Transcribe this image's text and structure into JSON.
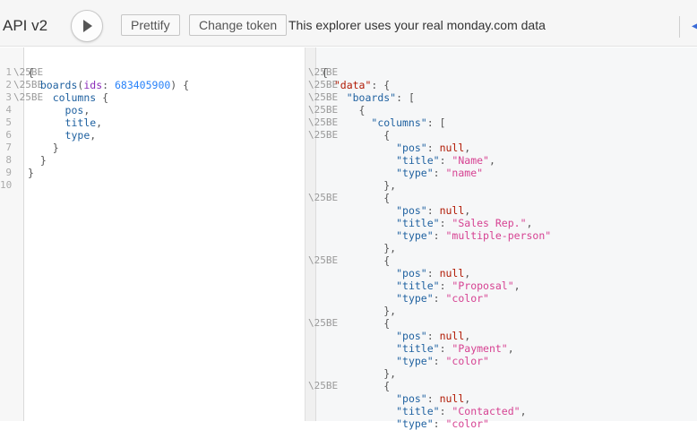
{
  "toolbar": {
    "title": "API v2",
    "prettify_label": "Prettify",
    "change_token_label": "Change token",
    "notice": "This explorer uses your real monday.com data",
    "accent_color": "#3a6bd8"
  },
  "fold_marker": "\\25BE",
  "query": {
    "line_numbers": [
      "1",
      "2",
      "3",
      "4",
      "5",
      "6",
      "7",
      "8",
      "9",
      "10"
    ],
    "lines": [
      [
        {
          "t": "{",
          "c": "p"
        }
      ],
      [
        {
          "t": "  ",
          "c": "p"
        },
        {
          "t": "boards",
          "c": "f"
        },
        {
          "t": "(",
          "c": "p"
        },
        {
          "t": "ids",
          "c": "a"
        },
        {
          "t": ": ",
          "c": "p"
        },
        {
          "t": "683405900",
          "c": "n"
        },
        {
          "t": ") {",
          "c": "p"
        }
      ],
      [
        {
          "t": "    ",
          "c": "p"
        },
        {
          "t": "columns",
          "c": "f"
        },
        {
          "t": " {",
          "c": "p"
        }
      ],
      [
        {
          "t": "      ",
          "c": "p"
        },
        {
          "t": "pos",
          "c": "f"
        },
        {
          "t": ",",
          "c": "p"
        }
      ],
      [
        {
          "t": "      ",
          "c": "p"
        },
        {
          "t": "title",
          "c": "f"
        },
        {
          "t": ",",
          "c": "p"
        }
      ],
      [
        {
          "t": "      ",
          "c": "p"
        },
        {
          "t": "type",
          "c": "f"
        },
        {
          "t": ",",
          "c": "p"
        }
      ],
      [
        {
          "t": "    }",
          "c": "p"
        }
      ],
      [
        {
          "t": "  }",
          "c": "p"
        }
      ],
      [
        {
          "t": "}",
          "c": "p"
        }
      ],
      [
        {
          "t": "",
          "c": "p"
        }
      ]
    ]
  },
  "result": {
    "lines": [
      [
        {
          "t": "{",
          "c": "p"
        }
      ],
      [
        {
          "t": "  ",
          "c": "p"
        },
        {
          "t": "\"data\"",
          "c": "kw"
        },
        {
          "t": ": {",
          "c": "p"
        }
      ],
      [
        {
          "t": "    ",
          "c": "p"
        },
        {
          "t": "\"boards\"",
          "c": "rk"
        },
        {
          "t": ": [",
          "c": "p"
        }
      ],
      [
        {
          "t": "      {",
          "c": "p"
        }
      ],
      [
        {
          "t": "        ",
          "c": "p"
        },
        {
          "t": "\"columns\"",
          "c": "rk"
        },
        {
          "t": ": [",
          "c": "p"
        }
      ],
      [
        {
          "t": "          {",
          "c": "p"
        }
      ],
      [
        {
          "t": "            ",
          "c": "p"
        },
        {
          "t": "\"pos\"",
          "c": "rk"
        },
        {
          "t": ": ",
          "c": "p"
        },
        {
          "t": "null",
          "c": "kw"
        },
        {
          "t": ",",
          "c": "p"
        }
      ],
      [
        {
          "t": "            ",
          "c": "p"
        },
        {
          "t": "\"title\"",
          "c": "rk"
        },
        {
          "t": ": ",
          "c": "p"
        },
        {
          "t": "\"Name\"",
          "c": "s"
        },
        {
          "t": ",",
          "c": "p"
        }
      ],
      [
        {
          "t": "            ",
          "c": "p"
        },
        {
          "t": "\"type\"",
          "c": "rk"
        },
        {
          "t": ": ",
          "c": "p"
        },
        {
          "t": "\"name\"",
          "c": "s"
        }
      ],
      [
        {
          "t": "          },",
          "c": "p"
        }
      ],
      [
        {
          "t": "          {",
          "c": "p"
        }
      ],
      [
        {
          "t": "            ",
          "c": "p"
        },
        {
          "t": "\"pos\"",
          "c": "rk"
        },
        {
          "t": ": ",
          "c": "p"
        },
        {
          "t": "null",
          "c": "kw"
        },
        {
          "t": ",",
          "c": "p"
        }
      ],
      [
        {
          "t": "            ",
          "c": "p"
        },
        {
          "t": "\"title\"",
          "c": "rk"
        },
        {
          "t": ": ",
          "c": "p"
        },
        {
          "t": "\"Sales Rep.\"",
          "c": "s"
        },
        {
          "t": ",",
          "c": "p"
        }
      ],
      [
        {
          "t": "            ",
          "c": "p"
        },
        {
          "t": "\"type\"",
          "c": "rk"
        },
        {
          "t": ": ",
          "c": "p"
        },
        {
          "t": "\"multiple-person\"",
          "c": "s"
        }
      ],
      [
        {
          "t": "          },",
          "c": "p"
        }
      ],
      [
        {
          "t": "          {",
          "c": "p"
        }
      ],
      [
        {
          "t": "            ",
          "c": "p"
        },
        {
          "t": "\"pos\"",
          "c": "rk"
        },
        {
          "t": ": ",
          "c": "p"
        },
        {
          "t": "null",
          "c": "kw"
        },
        {
          "t": ",",
          "c": "p"
        }
      ],
      [
        {
          "t": "            ",
          "c": "p"
        },
        {
          "t": "\"title\"",
          "c": "rk"
        },
        {
          "t": ": ",
          "c": "p"
        },
        {
          "t": "\"Proposal\"",
          "c": "s"
        },
        {
          "t": ",",
          "c": "p"
        }
      ],
      [
        {
          "t": "            ",
          "c": "p"
        },
        {
          "t": "\"type\"",
          "c": "rk"
        },
        {
          "t": ": ",
          "c": "p"
        },
        {
          "t": "\"color\"",
          "c": "s"
        }
      ],
      [
        {
          "t": "          },",
          "c": "p"
        }
      ],
      [
        {
          "t": "          {",
          "c": "p"
        }
      ],
      [
        {
          "t": "            ",
          "c": "p"
        },
        {
          "t": "\"pos\"",
          "c": "rk"
        },
        {
          "t": ": ",
          "c": "p"
        },
        {
          "t": "null",
          "c": "kw"
        },
        {
          "t": ",",
          "c": "p"
        }
      ],
      [
        {
          "t": "            ",
          "c": "p"
        },
        {
          "t": "\"title\"",
          "c": "rk"
        },
        {
          "t": ": ",
          "c": "p"
        },
        {
          "t": "\"Payment\"",
          "c": "s"
        },
        {
          "t": ",",
          "c": "p"
        }
      ],
      [
        {
          "t": "            ",
          "c": "p"
        },
        {
          "t": "\"type\"",
          "c": "rk"
        },
        {
          "t": ": ",
          "c": "p"
        },
        {
          "t": "\"color\"",
          "c": "s"
        }
      ],
      [
        {
          "t": "          },",
          "c": "p"
        }
      ],
      [
        {
          "t": "          {",
          "c": "p"
        }
      ],
      [
        {
          "t": "            ",
          "c": "p"
        },
        {
          "t": "\"pos\"",
          "c": "rk"
        },
        {
          "t": ": ",
          "c": "p"
        },
        {
          "t": "null",
          "c": "kw"
        },
        {
          "t": ",",
          "c": "p"
        }
      ],
      [
        {
          "t": "            ",
          "c": "p"
        },
        {
          "t": "\"title\"",
          "c": "rk"
        },
        {
          "t": ": ",
          "c": "p"
        },
        {
          "t": "\"Contacted\"",
          "c": "s"
        },
        {
          "t": ",",
          "c": "p"
        }
      ],
      [
        {
          "t": "            ",
          "c": "p"
        },
        {
          "t": "\"type\"",
          "c": "rk"
        },
        {
          "t": ": ",
          "c": "p"
        },
        {
          "t": "\"color\"",
          "c": "s"
        }
      ]
    ]
  }
}
